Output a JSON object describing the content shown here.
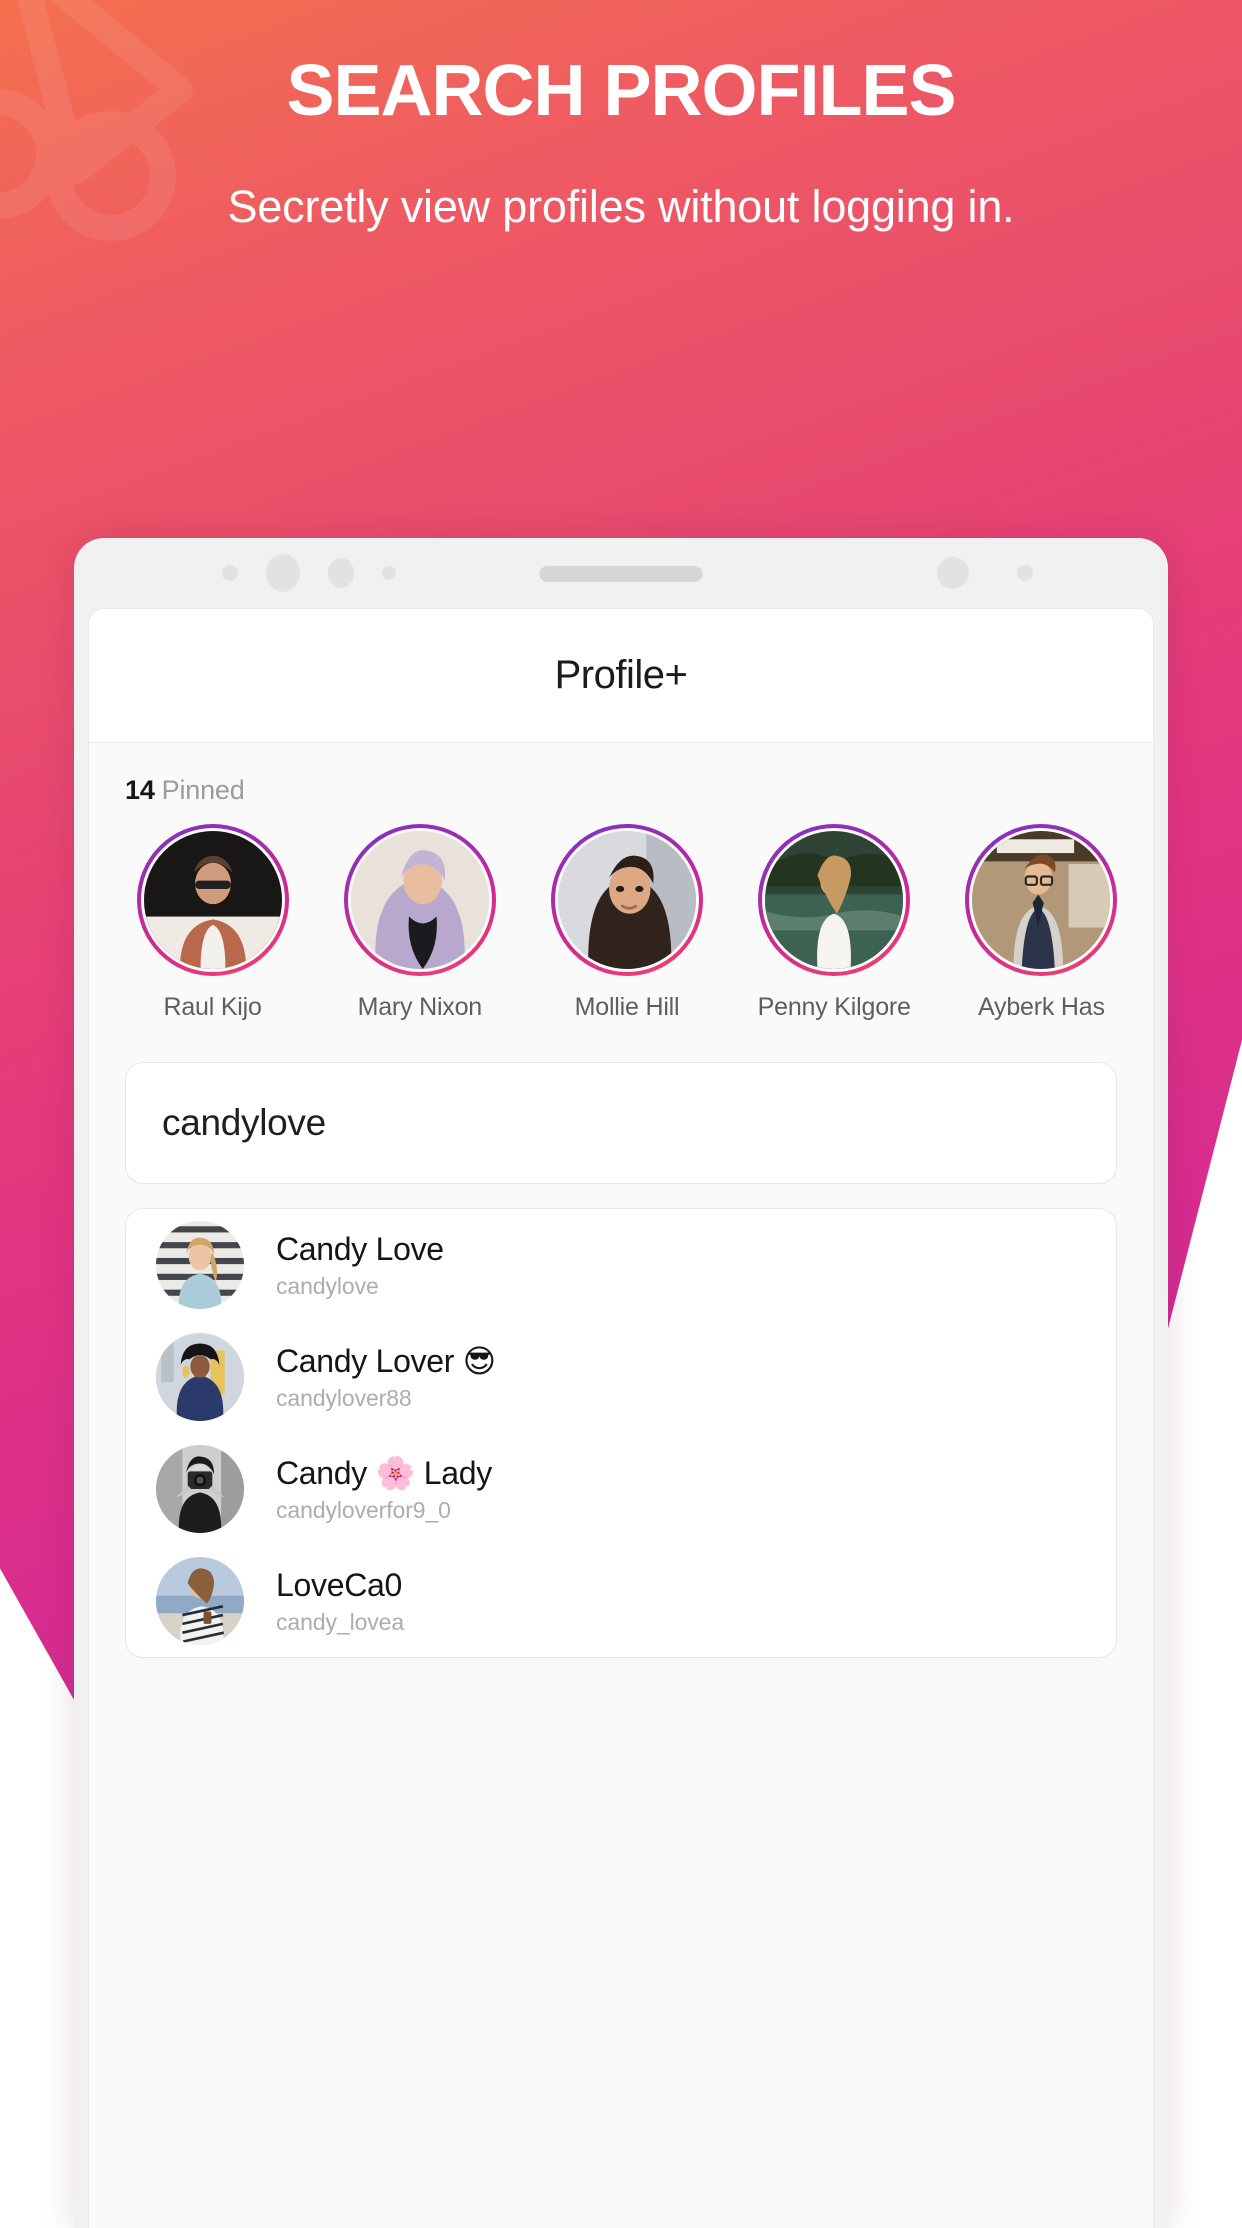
{
  "promo": {
    "title": "SEARCH PROFILES",
    "subtitle": "Secretly view profiles without logging in."
  },
  "colors": {
    "gradient_start": "#f4704e",
    "gradient_mid": "#e3357f",
    "gradient_end": "#ad2bab",
    "ring_start": "#7b34c4",
    "ring_end": "#f2436c",
    "text_dark": "#151515",
    "text_muted": "#adadad"
  },
  "app": {
    "title": "Profile+",
    "pinned": {
      "count": "14",
      "label": "Pinned",
      "items": [
        {
          "name": "Raul Kijo",
          "icon": "avatar-raul-kijo"
        },
        {
          "name": "Mary Nixon",
          "icon": "avatar-mary-nixon"
        },
        {
          "name": "Mollie Hill",
          "icon": "avatar-mollie-hill"
        },
        {
          "name": "Penny Kilgore",
          "icon": "avatar-penny-kilgore"
        },
        {
          "name": "Ayberk Has",
          "icon": "avatar-ayberk-has"
        }
      ]
    },
    "search": {
      "value": "candylove",
      "placeholder": "Search"
    },
    "results": [
      {
        "name": "Candy Love",
        "handle": "candylove",
        "icon": "avatar-candy-love"
      },
      {
        "name": "Candy Lover 😎",
        "handle": "candylover88",
        "icon": "avatar-candy-lover"
      },
      {
        "name": "Candy 🌸 Lady",
        "handle": "candyloverfor9_0",
        "icon": "avatar-candy-lady"
      },
      {
        "name": "LoveCa0",
        "handle": "candy_lovea",
        "icon": "avatar-loveca0"
      }
    ]
  },
  "phone_chrome": {
    "sensors_left": [
      "sensor-dot-small",
      "sensor-dot-large",
      "sensor-dot-medium",
      "sensor-dot-tiny"
    ],
    "speaker": "speaker-grille",
    "sensors_right": [
      "camera-lens",
      "sensor-dot-small"
    ]
  }
}
